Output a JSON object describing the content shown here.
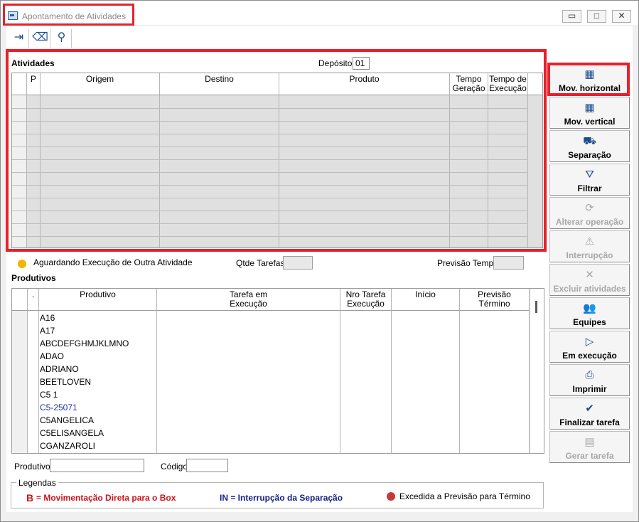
{
  "window": {
    "title": "Apontamento de Atividades",
    "controls": {
      "minimize": "▭",
      "maximize": "□",
      "close": "✕"
    }
  },
  "toolbar": {
    "icons": [
      "exit-icon",
      "eraser-icon",
      "search-icon"
    ],
    "glyphs": {
      "exit": "⇥",
      "eraser": "⌫",
      "search": "⚲"
    }
  },
  "atividades": {
    "section_label": "Atividades",
    "deposito_label": "Depósito",
    "deposito_value": "01",
    "columns": [
      "P",
      "Origem",
      "Destino",
      "Produto",
      "Tempo\nGeração",
      "Tempo de\nExecução"
    ],
    "col_p": "P",
    "col_origem": "Origem",
    "col_destino": "Destino",
    "col_produto": "Produto",
    "col_tempo_geracao_1": "Tempo",
    "col_tempo_geracao_2": "Geração",
    "col_tempo_execucao_1": "Tempo de",
    "col_tempo_execucao_2": "Execução"
  },
  "status": {
    "aguardando_label": "Aguardando Execução de Outra Atividade",
    "aguardando_color": "#f5b400",
    "qtde_tarefas_label": "Qtde Tarefas",
    "previsao_tempo_label": "Previsão Tempo"
  },
  "produtivos": {
    "section_label": "Produtivos",
    "col_dot": ".",
    "col_produtivo": "Produtivo",
    "col_tarefa_1": "Tarefa em",
    "col_tarefa_2": "Execução",
    "col_nro_1": "Nro Tarefa",
    "col_nro_2": "Execução",
    "col_inicio": "Início",
    "col_previsao_1": "Previsão",
    "col_previsao_2": "Término",
    "rows": [
      {
        "name": "A16",
        "color": "#000000"
      },
      {
        "name": "A17",
        "color": "#000000"
      },
      {
        "name": "ABCDEFGHMJKLMNO",
        "color": "#000000"
      },
      {
        "name": "ADAO",
        "color": "#000000"
      },
      {
        "name": "ADRIANO",
        "color": "#000000"
      },
      {
        "name": "BEETLOVEN",
        "color": "#000000"
      },
      {
        "name": "C5 1",
        "color": "#000000"
      },
      {
        "name": "C5-25071",
        "color": "#1a2fa0"
      },
      {
        "name": "C5ANGELICA",
        "color": "#000000"
      },
      {
        "name": "C5ELISANGELA",
        "color": "#000000"
      },
      {
        "name": "CGANZAROLI",
        "color": "#000000"
      }
    ]
  },
  "filters": {
    "produtivo_label": "Produtivo",
    "codigo_label": "Código"
  },
  "legendas": {
    "title": "Legendas",
    "b_letter": "B",
    "b_text": "= Movimentação Direta para o Box",
    "b_color": "#d0121b",
    "in_text": "IN = Interrupção da Separação",
    "in_color": "#15208a",
    "excedida_text": "Excedida a Previsão para Término",
    "excedida_color": "#c43a3a"
  },
  "side_buttons": [
    {
      "label": "Mov. horizontal",
      "icon": "pallet-horizontal-icon",
      "glyph": "▦",
      "enabled": true
    },
    {
      "label": "Mov. vertical",
      "icon": "pallet-vertical-icon",
      "glyph": "▦",
      "enabled": true
    },
    {
      "label": "Separação",
      "icon": "hand-truck-icon",
      "glyph": "⛟",
      "enabled": true
    },
    {
      "label": "Filtrar",
      "icon": "filter-icon",
      "glyph": "⛛",
      "enabled": true
    },
    {
      "label": "Alterar operação",
      "icon": "refresh-icon",
      "glyph": "⟳",
      "enabled": false
    },
    {
      "label": "Interrupção",
      "icon": "warning-icon",
      "glyph": "⚠",
      "enabled": false
    },
    {
      "label": "Excluir atividades",
      "icon": "close-icon",
      "glyph": "✕",
      "enabled": false
    },
    {
      "label": "Equipes",
      "icon": "users-icon",
      "glyph": "👥",
      "enabled": true
    },
    {
      "label": "Em execução",
      "icon": "play-icon",
      "glyph": "▷",
      "enabled": true
    },
    {
      "label": "Imprimir",
      "icon": "printer-icon",
      "glyph": "⎙",
      "enabled": true
    },
    {
      "label": "Finalizar tarefa",
      "icon": "check-icon",
      "glyph": "✔",
      "enabled": true
    },
    {
      "label": "Gerar tarefa",
      "icon": "document-icon",
      "glyph": "▤",
      "enabled": false
    }
  ]
}
